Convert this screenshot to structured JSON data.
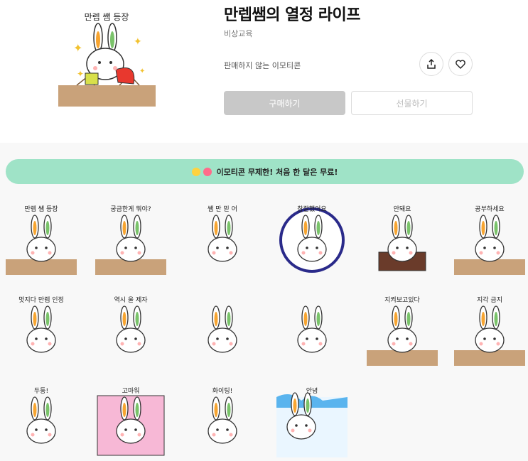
{
  "product": {
    "title": "만렙쌤의 열정 라이프",
    "publisher": "비상교육",
    "sale_note": "판매하지 않는 이모티콘",
    "hero_caption": "만렙 쌤 등장"
  },
  "actions": {
    "share_icon": "share-icon",
    "like_icon": "heart-icon",
    "buy_label": "구매하기",
    "gift_label": "선물하기"
  },
  "promo": {
    "text": "이모티콘 무제한! 처음 한 달은 무료!"
  },
  "stickers": [
    {
      "caption": "만렙 쌤 등장"
    },
    {
      "caption": "궁금한게 뭐야?"
    },
    {
      "caption": "쌤 만 믿 어"
    },
    {
      "caption": "참잘했어요"
    },
    {
      "caption": "안돼요"
    },
    {
      "caption": "공부하세요"
    },
    {
      "caption": "멋지다 만렙 인정"
    },
    {
      "caption": "역시 울 제자"
    },
    {
      "caption": ""
    },
    {
      "caption": ""
    },
    {
      "caption": "지켜보고있다"
    },
    {
      "caption": "지각 금지"
    },
    {
      "caption": "두둥!"
    },
    {
      "caption": "고마워"
    },
    {
      "caption": "화이팅!"
    },
    {
      "caption": "안녕"
    }
  ],
  "colors": {
    "promo_bg": "#9fe3c7",
    "buy_bg": "#c8c8c8",
    "gallery_bg": "#f8f8f8"
  }
}
